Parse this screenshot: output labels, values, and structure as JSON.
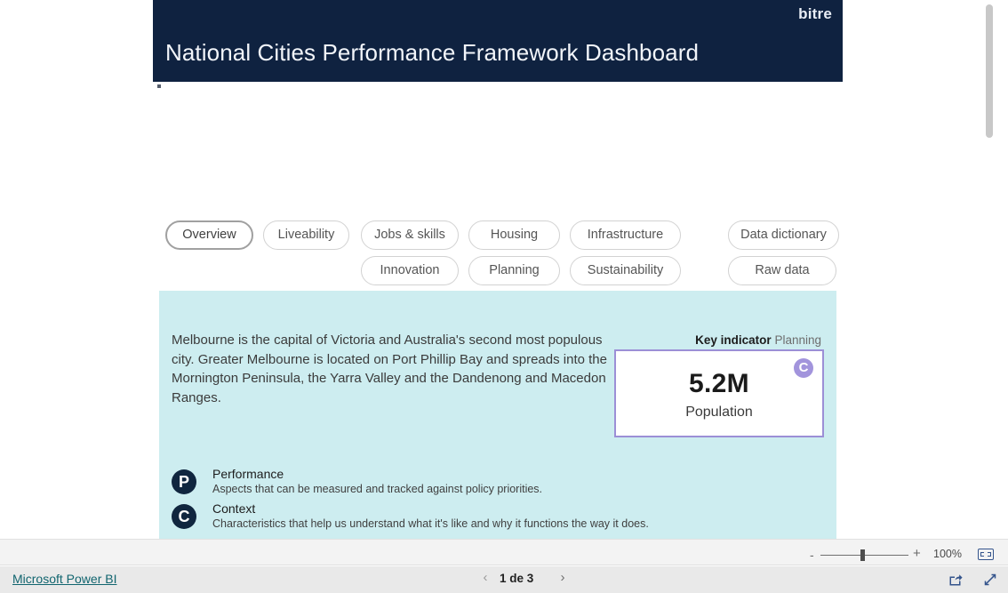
{
  "header": {
    "logo": "bitre",
    "title": "National Cities Performance Framework Dashboard",
    "bg_color": "#0f2240"
  },
  "nav": {
    "row1": [
      {
        "label": "Overview",
        "selected": true
      },
      {
        "label": "Liveability",
        "selected": false
      },
      {
        "label": "Jobs & skills",
        "selected": false
      },
      {
        "label": "Housing",
        "selected": false
      },
      {
        "label": "Infrastructure",
        "selected": false
      },
      {
        "label": "Data dictionary",
        "selected": false
      }
    ],
    "row2": [
      {
        "label": "Innovation",
        "selected": false
      },
      {
        "label": "Planning",
        "selected": false
      },
      {
        "label": "Sustainability",
        "selected": false
      },
      {
        "label": "Raw data",
        "selected": false
      }
    ]
  },
  "panel": {
    "bg_color": "#cdedf0",
    "description": "Melbourne is the capital of Victoria and Australia's second most populous city. Greater Melbourne is located on Port Phillip Bay and spreads into the Mornington Peninsula, the Yarra Valley and the Dandenong and Macedon Ranges.",
    "key_indicator": {
      "caption_bold": "Key indicator",
      "caption_rest": "Planning",
      "value": "5.2M",
      "label": "Population",
      "badge": "C",
      "badge_color": "#a294dc",
      "border_color": "#9c8fd6"
    },
    "legend": [
      {
        "badge": "P",
        "title": "Performance",
        "description": "Aspects that can be measured and tracked against policy priorities."
      },
      {
        "badge": "C",
        "title": "Context",
        "description": "Characteristics that help us understand what it's like and why it functions the way it does."
      }
    ]
  },
  "zoom_toolbar": {
    "minus": "-",
    "plus": "+",
    "level": "100%",
    "fit_icon": "fit-to-page-icon"
  },
  "status_bar": {
    "brand_link": "Microsoft Power BI",
    "page_indicator": "1 de 3",
    "prev_icon": "chevron-left-icon",
    "next_icon": "chevron-right-icon",
    "share_icon": "share-icon",
    "fullscreen_icon": "fullscreen-icon"
  }
}
